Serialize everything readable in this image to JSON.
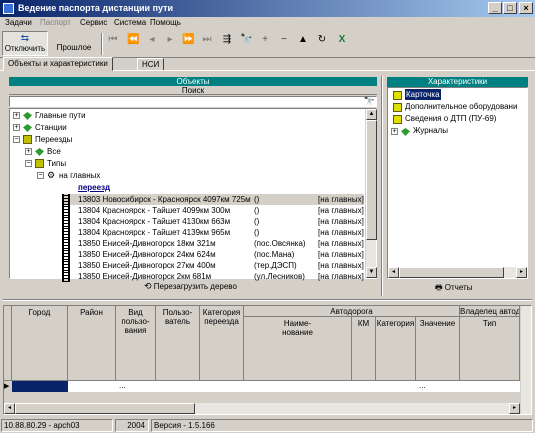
{
  "window": {
    "title": "Ведение паспорта дистанции пути"
  },
  "menu": [
    "Задачи",
    "Паспорт",
    "Сервис",
    "Система",
    "Помощь"
  ],
  "toolbar": {
    "disconnect": "Отключить",
    "previous": "Прошлое"
  },
  "tabs": [
    "Объекты и характеристики",
    "НСИ"
  ],
  "objects_panel": {
    "header": "Объекты",
    "search_label": "Поиск",
    "reload_button": "Перезагрузить дерево",
    "tree": [
      {
        "label": "Главные пути"
      },
      {
        "label": "Станции"
      },
      {
        "label": "Переезды"
      },
      {
        "label": "Все"
      },
      {
        "label": "Типы"
      },
      {
        "label": "на главных"
      },
      {
        "label": "переезд"
      }
    ],
    "rows": [
      {
        "name": "13803 Новосибирск - Красноярск 4097км 725м",
        "note": "()",
        "type": "[на главных]"
      },
      {
        "name": "13804 Красноярск - Тайшет 4099км 300м",
        "note": "()",
        "type": "[на главных]"
      },
      {
        "name": "13804 Красноярск - Тайшет 4130км 663м",
        "note": "()",
        "type": "[на главных]"
      },
      {
        "name": "13804 Красноярск - Тайшет 4139км 965м",
        "note": "()",
        "type": "[на главных]"
      },
      {
        "name": "13850 Енисей-Дивногорск 18км 321м",
        "note": "(пос.Овсянка)",
        "type": "[на главных]"
      },
      {
        "name": "13850 Енисей-Дивногорск 24км 624м",
        "note": "(пос.Мана)",
        "type": "[на главных]"
      },
      {
        "name": "13850 Енисей-Дивногорск 27км 400м",
        "note": "(тер.ДЭСП)",
        "type": "[на главных]"
      },
      {
        "name": "13850 Енисей-Дивногорск 2км 681м",
        "note": "(ул.Лесников)",
        "type": "[на главных]"
      }
    ]
  },
  "chars_panel": {
    "header": "Характеристики",
    "items": [
      "Карточка",
      "Дополнительное оборудовани",
      "Сведения о ДТП (ПУ-69)",
      "Журналы"
    ],
    "reports_button": "Отчеты"
  },
  "grid": {
    "headers": {
      "gorod": "Город",
      "rayon": "Район",
      "vid": "Вид\nпользо-\nвания",
      "polz": "Пользо-\nватель",
      "kat": "Категория\nпереезда",
      "avtodoroga": "Автодорога",
      "naim": "Наиме-\nнование",
      "km": "КМ",
      "kat2": "Категория",
      "znach": "Значение",
      "vlad": "Владелец автодо",
      "tip": "Тип"
    },
    "row": {
      "vid": "...",
      "znach": "..."
    }
  },
  "status": {
    "host": "10.88.80.29 - apch03",
    "year": "2004",
    "version": "Версия - 1.5.166"
  }
}
